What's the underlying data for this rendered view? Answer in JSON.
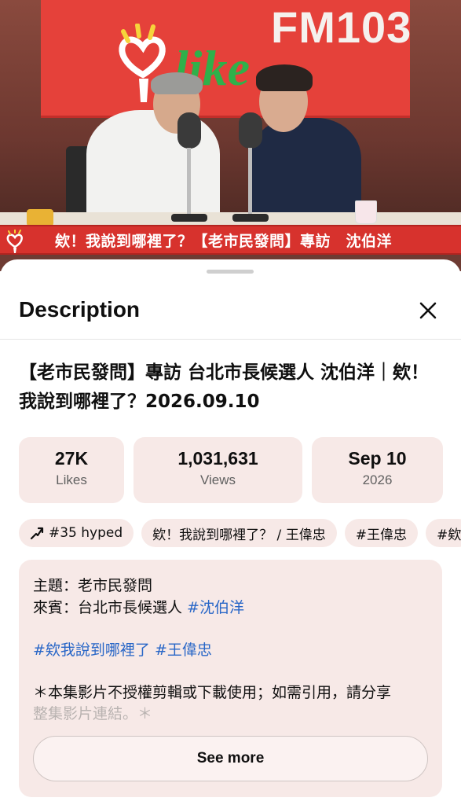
{
  "video": {
    "sign_text": "FM103",
    "sign_logo_word": "like",
    "banner_text": "欸！我說到哪裡了？【老市民發問】專訪　沈伯洋"
  },
  "sheet": {
    "header": "Description",
    "title": "【老市民發問】專訪 台北市長候選人 沈伯洋｜欸！我說到哪裡了？2026.09.10",
    "stats": [
      {
        "value": "27K",
        "label": "Likes"
      },
      {
        "value": "1,031,631",
        "label": "Views"
      },
      {
        "value": "Sep 10",
        "label": "2026"
      }
    ],
    "chips": [
      "#35 hyped",
      "欸！我說到哪裡了？ / 王偉忠",
      "#王偉忠",
      "#欸"
    ],
    "body": {
      "line1": "主題：老市民發問",
      "line2_prefix": "來賓：台北市長候選人 ",
      "line2_link": "#沈伯洋",
      "line3_link1": "#欸我說到哪裡了",
      "line3_link2": "#王偉忠",
      "line4": "＊本集影片不授權剪輯或下載使用；如需引用，請分享",
      "line5": "整集影片連結。＊"
    },
    "see_more": "See more"
  },
  "colors": {
    "chip_bg": "#f7e9e7",
    "link": "#2866c7",
    "banner_red": "#d7322d"
  }
}
